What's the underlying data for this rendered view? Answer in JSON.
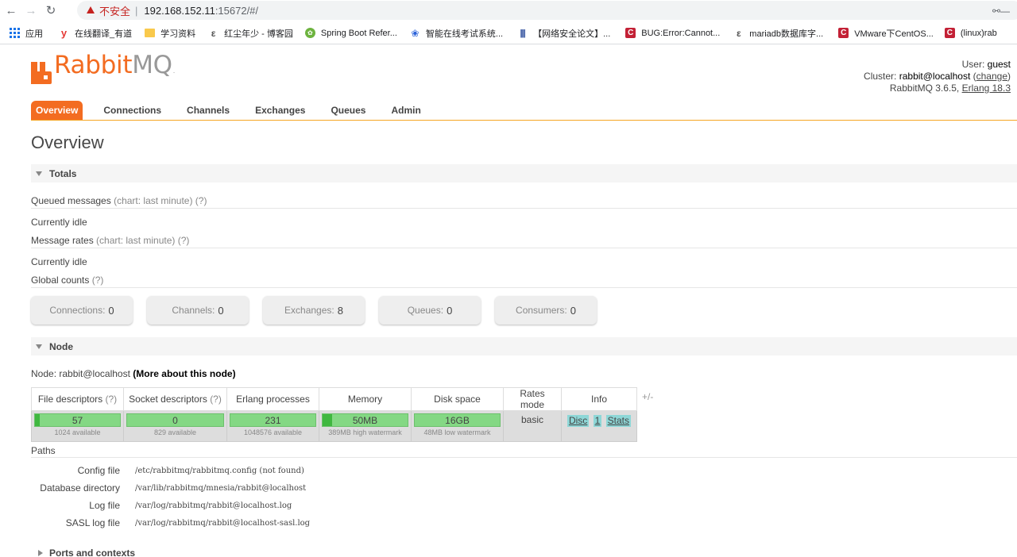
{
  "browser": {
    "insecure_label": "不安全",
    "url_host": "192.168.152.11",
    "url_rest": ":15672/#/",
    "bookmarks": [
      {
        "label": "应用",
        "icon": "apps-grid-icon"
      },
      {
        "label": "在线翻译_有道",
        "icon": "youdao-icon"
      },
      {
        "label": "学习资料",
        "icon": "folder-icon"
      },
      {
        "label": "红尘年少 - 博客园",
        "icon": "cnblogs-icon"
      },
      {
        "label": "Spring Boot Refer...",
        "icon": "spring-icon"
      },
      {
        "label": "智能在线考试系统...",
        "icon": "baidu-paw-icon"
      },
      {
        "label": "【网络安全论文】...",
        "icon": "cnki-icon"
      },
      {
        "label": "BUG:Error:Cannot...",
        "icon": "csdn-icon"
      },
      {
        "label": "mariadb数据库字...",
        "icon": "cnblogs-icon"
      },
      {
        "label": "VMware下CentOS...",
        "icon": "csdn-icon"
      },
      {
        "label": "(linux)rab",
        "icon": "csdn-icon"
      }
    ]
  },
  "header": {
    "logo_rabbit": "Rabbit",
    "logo_mq": "MQ",
    "logo_dot": ".",
    "user_prefix": "User: ",
    "user": "guest",
    "cluster_prefix": "Cluster: ",
    "cluster": "rabbit@localhost",
    "change_open": " (",
    "change_label": "change",
    "change_close": ")",
    "version_prefix": "RabbitMQ 3.6.5, ",
    "erlang": "Erlang 18.3"
  },
  "tabs": [
    {
      "label": "Overview",
      "active": true
    },
    {
      "label": "Connections"
    },
    {
      "label": "Channels"
    },
    {
      "label": "Exchanges"
    },
    {
      "label": "Queues"
    },
    {
      "label": "Admin"
    }
  ],
  "page_title": "Overview",
  "totals": {
    "heading": "Totals",
    "queued_label": "Queued messages",
    "queued_chart": "(chart: last minute)",
    "queued_help": "(?)",
    "queued_state": "Currently idle",
    "rates_label": "Message rates",
    "rates_chart": "(chart: last minute)",
    "rates_help": "(?)",
    "rates_state": "Currently idle",
    "global_label": "Global counts",
    "global_help": "(?)",
    "counters": [
      {
        "label": "Connections:",
        "value": "0"
      },
      {
        "label": "Channels:",
        "value": "0"
      },
      {
        "label": "Exchanges:",
        "value": "8"
      },
      {
        "label": "Queues:",
        "value": "0"
      },
      {
        "label": "Consumers:",
        "value": "0"
      }
    ]
  },
  "node": {
    "heading": "Node",
    "node_prefix": "Node: ",
    "node_name": "rabbit@localhost",
    "more_link": "(More about this node)",
    "columns": {
      "fd": "File descriptors",
      "sd": "Socket descriptors",
      "help": "(?)",
      "erl": "Erlang processes",
      "mem": "Memory",
      "disk": "Disk space",
      "rates": "Rates mode",
      "info": "Info"
    },
    "plus_minus": "+/-",
    "fd_value": "57",
    "fd_sub": "1024 available",
    "sd_value": "0",
    "sd_sub": "829 available",
    "erl_value": "231",
    "erl_sub": "1048576 available",
    "mem_value": "50MB",
    "mem_sub": "389MB high watermark",
    "disk_value": "16GB",
    "disk_sub": "48MB low watermark",
    "rates_mode": "basic",
    "info_badges": [
      "Disc",
      "1",
      "Stats"
    ]
  },
  "paths": {
    "heading": "Paths",
    "rows": [
      {
        "label": "Config file",
        "value": "/etc/rabbitmq/rabbitmq.config (not found)"
      },
      {
        "label": "Database directory",
        "value": "/var/lib/rabbitmq/mnesia/rabbit@localhost"
      },
      {
        "label": "Log file",
        "value": "/var/log/rabbitmq/rabbit@localhost.log"
      },
      {
        "label": "SASL log file",
        "value": "/var/log/rabbitmq/rabbit@localhost-sasl.log"
      }
    ]
  },
  "ports": {
    "heading": "Ports and contexts"
  }
}
